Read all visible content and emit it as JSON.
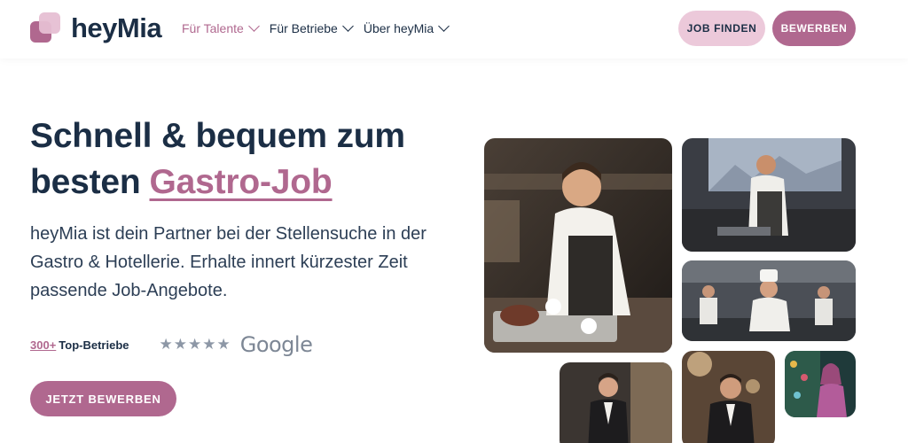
{
  "brand": {
    "name": "heyMia"
  },
  "nav": {
    "items": [
      {
        "label": "Für Talente"
      },
      {
        "label": "Für Betriebe"
      },
      {
        "label": "Über heyMia"
      }
    ]
  },
  "header": {
    "find_job_label": "JOB FINDEN",
    "apply_label": "BEWERBEN"
  },
  "hero": {
    "title_line1": "Schnell & bequem zum",
    "title_line2": "besten",
    "title_highlight": "Gastro-Job",
    "subtitle": "heyMia ist dein Partner bei der Stellensuche in der Gastro & Hotellerie. Erhalte innert kürzester Zeit passende Job-Angebote.",
    "stats_number": "300+",
    "stats_label": "Top-Betriebe",
    "stars": "★★★★★",
    "rating_source": "Google",
    "cta_label": "JETZT BEWERBEN"
  },
  "colors": {
    "accent": "#b0688f",
    "accent_light": "#ecc9da",
    "text_dark": "#1b2e45"
  },
  "icons": [
    "logo-icon",
    "chevron-down-icon",
    "star-icon"
  ]
}
